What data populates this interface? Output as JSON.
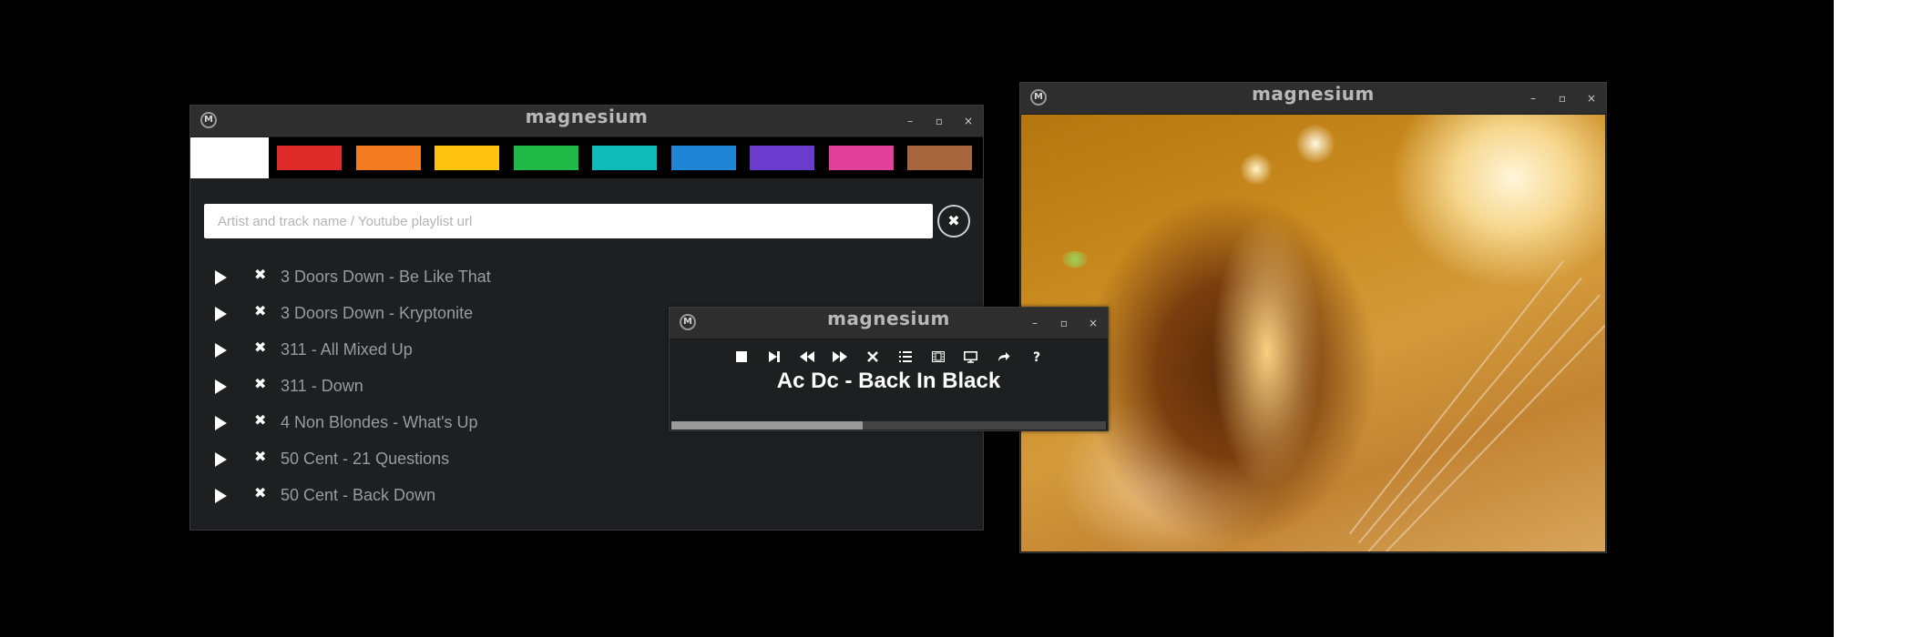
{
  "app_title": "magnesium",
  "window_controls": {
    "minimize": "–",
    "maximize": "▫",
    "close": "×"
  },
  "main_window": {
    "title": "magnesium",
    "swatches": [
      {
        "color": "#ffffff",
        "active": true
      },
      {
        "color": "#e02b2b"
      },
      {
        "color": "#f47c20"
      },
      {
        "color": "#ffc20e"
      },
      {
        "color": "#20b947"
      },
      {
        "color": "#0fbcb8"
      },
      {
        "color": "#1f86d6"
      },
      {
        "color": "#6a3bcc"
      },
      {
        "color": "#e2409a"
      },
      {
        "color": "#a8663f"
      }
    ],
    "search": {
      "placeholder": "Artist and track name / Youtube playlist url",
      "value": ""
    },
    "clear_label": "✖",
    "playlist": [
      "3 Doors Down - Be Like That",
      "3 Doors Down - Kryptonite",
      "311 - All Mixed Up",
      "311 - Down",
      "4 Non Blondes - What's Up",
      "50 Cent - 21 Questions",
      "50 Cent - Back Down"
    ],
    "delete_glyph": "✖"
  },
  "mini_player": {
    "title": "magnesium",
    "controls": [
      "stop-icon",
      "next-track-icon",
      "rewind-icon",
      "fast-forward-icon",
      "close-icon",
      "list-icon",
      "film-icon",
      "monitor-icon",
      "share-icon",
      "help-icon"
    ],
    "now_playing": "Ac Dc - Back In Black",
    "progress": 0.44
  },
  "video_window": {
    "title": "magnesium"
  }
}
